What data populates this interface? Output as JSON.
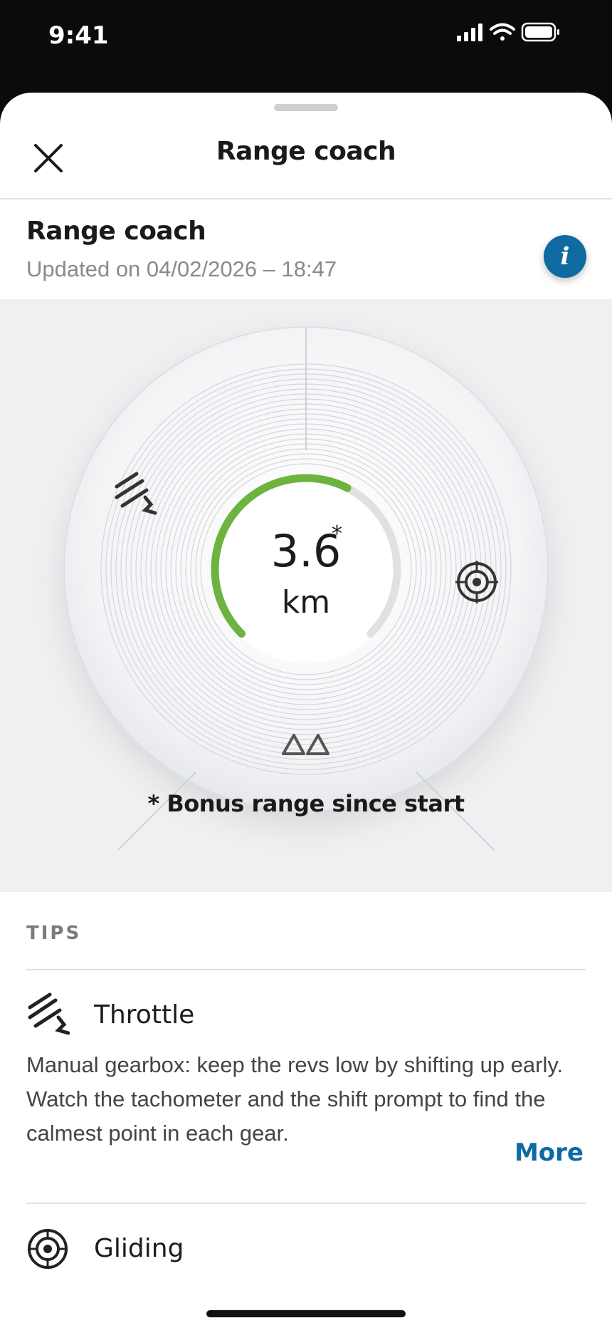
{
  "status_bar": {
    "time": "9:41"
  },
  "header": {
    "title": "Range coach"
  },
  "info_card": {
    "title": "Range coach",
    "updated": "Updated on 04/02/2026 – 18:47"
  },
  "gauge": {
    "value": "3.6",
    "asterisk": "*",
    "unit": "km",
    "note": "* Bonus range since start",
    "progress_fraction": 0.6,
    "accent_color": "#6db33f"
  },
  "tips": {
    "label": "TIPS",
    "items": [
      {
        "icon": "throttle-icon",
        "title": "Throttle",
        "body": "Manual gearbox: keep the revs low by shifting up early. Watch the tachometer and the shift prompt to find the calmest point in each gear.",
        "more": "More"
      },
      {
        "icon": "gliding-icon",
        "title": "Gliding"
      }
    ]
  },
  "colors": {
    "brand": "#0e6aa0",
    "accent": "#6db33f"
  }
}
